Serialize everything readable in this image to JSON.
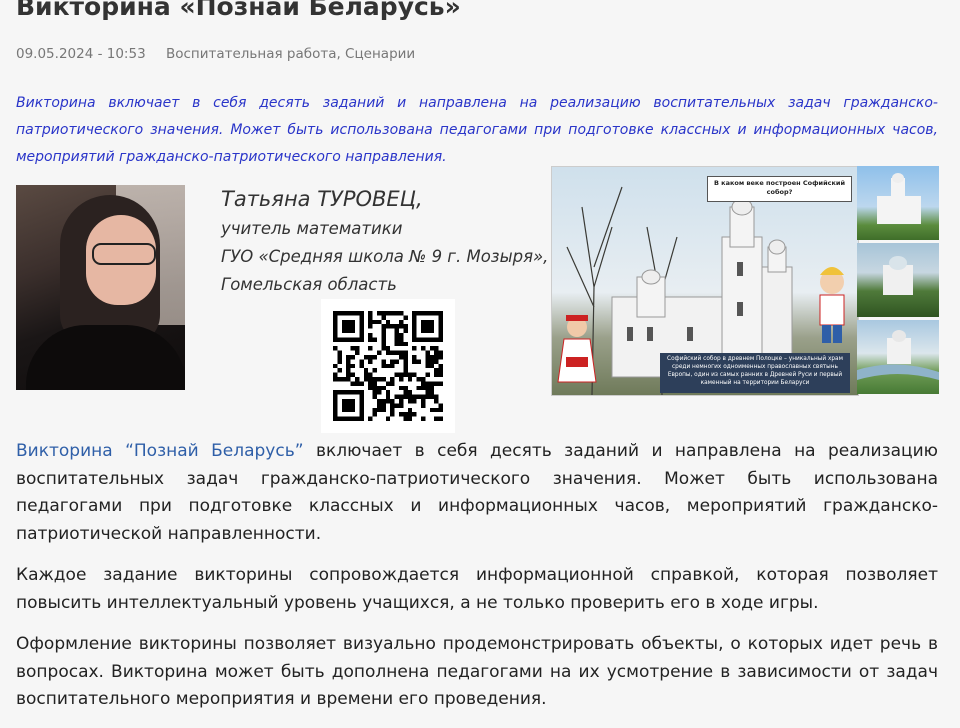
{
  "article": {
    "title": "Викторина «Познай Беларусь»",
    "date": "09.05.2024 - 10:53",
    "categories": "Воспитательная работа, Сценарии",
    "lead": "Викторина включает в себя десять заданий и направлена на реализацию воспитательных задач гражданско-патриотического значения. Может быть использована педагогами при подготовке классных и информационных часов, мероприятий гражданско-патриотического направления."
  },
  "author": {
    "name": "Татьяна ТУРОВЕЦ,",
    "position": "учитель математики",
    "school": "ГУО «Средняя школа № 9 г. Мозыря»,",
    "region": "Гомельская область"
  },
  "poster": {
    "question": "В каком веке построен Софийский собор?",
    "caption": "Софийский собор в древнем Полоцке – уникальный храм среди немногих одноименных православных святынь Европы, один из самых ранних в Древней Руси и первый каменный на территории Беларуси"
  },
  "body": {
    "p1_link": "Викторина “Познай Беларусь”",
    "p1_rest": " включает в себя десять заданий и направлена на реализацию воспитательных задач гражданско-патриотического значения. Может быть использована педагогами при подготовке классных и информационных часов, мероприятий гражданско-патриотической направленности.",
    "p2": "Каждое задание викторины сопровождается информационной справкой, которая позволяет повысить интеллектуальный уровень учащихся, а не только проверить его в ходе игры.",
    "p3": "Оформление викторины позволяет визуально продемонстрировать объекты, о которых идет речь в вопросах. Викторина может быть дополнена педагогами на их усмотрение в зависимости от задач воспитательного мероприятия и времени его проведения."
  },
  "icons": {
    "qr": "qr-code-icon"
  }
}
